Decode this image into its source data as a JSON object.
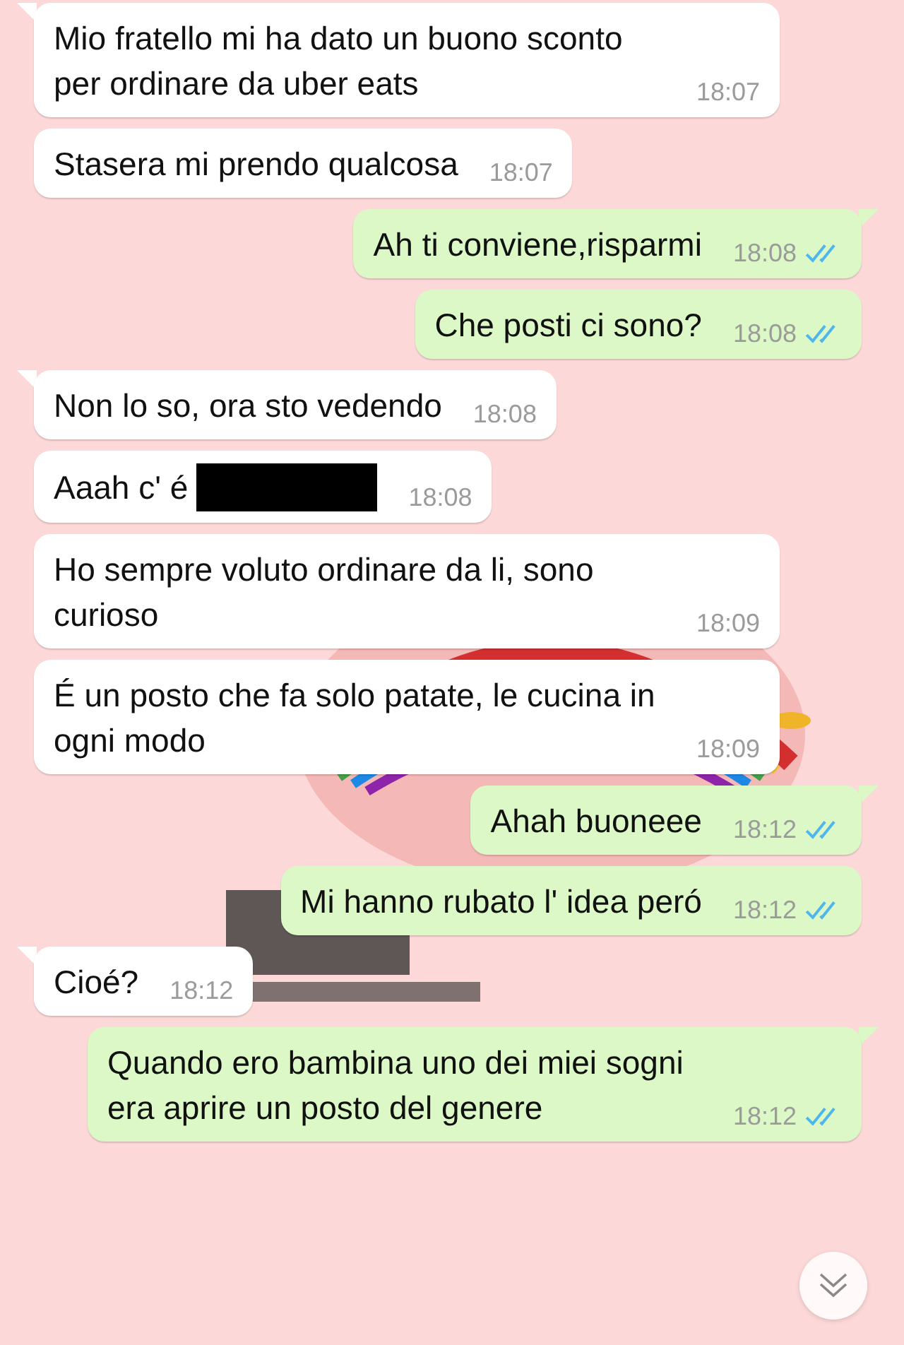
{
  "messages": [
    {
      "kind": "in",
      "text": "Mio fratello mi ha dato un buono sconto per ordinare da uber eats",
      "time": "18:07",
      "tail": true
    },
    {
      "kind": "in",
      "text": "Stasera mi prendo qualcosa",
      "time": "18:07",
      "tail": false
    },
    {
      "kind": "out",
      "text": "Ah ti conviene,risparmi",
      "time": "18:08",
      "tail": true,
      "read": true
    },
    {
      "kind": "out",
      "text": "Che posti ci sono?",
      "time": "18:08",
      "tail": false,
      "read": true
    },
    {
      "kind": "in",
      "text": "Non lo so, ora sto vedendo",
      "time": "18:08",
      "tail": true
    },
    {
      "kind": "in",
      "text": "Aaah c' é",
      "time": "18:08",
      "tail": false,
      "redacted": true
    },
    {
      "kind": "in",
      "text": "Ho sempre voluto ordinare da li, sono curioso",
      "time": "18:09",
      "tail": false
    },
    {
      "kind": "in",
      "text": "É un posto che fa solo patate, le cucina in ogni modo",
      "time": "18:09",
      "tail": false
    },
    {
      "kind": "out",
      "text": "Ahah buoneee",
      "time": "18:12",
      "tail": true,
      "read": true
    },
    {
      "kind": "out",
      "text": "Mi hanno rubato l' idea peró",
      "time": "18:12",
      "tail": false,
      "read": true
    },
    {
      "kind": "in",
      "text": "Cioé?",
      "time": "18:12",
      "tail": true
    },
    {
      "kind": "out",
      "text": "Quando ero bambina uno dei miei sogni era aprire un posto del genere",
      "time": "18:12",
      "tail": true,
      "read": true
    }
  ]
}
